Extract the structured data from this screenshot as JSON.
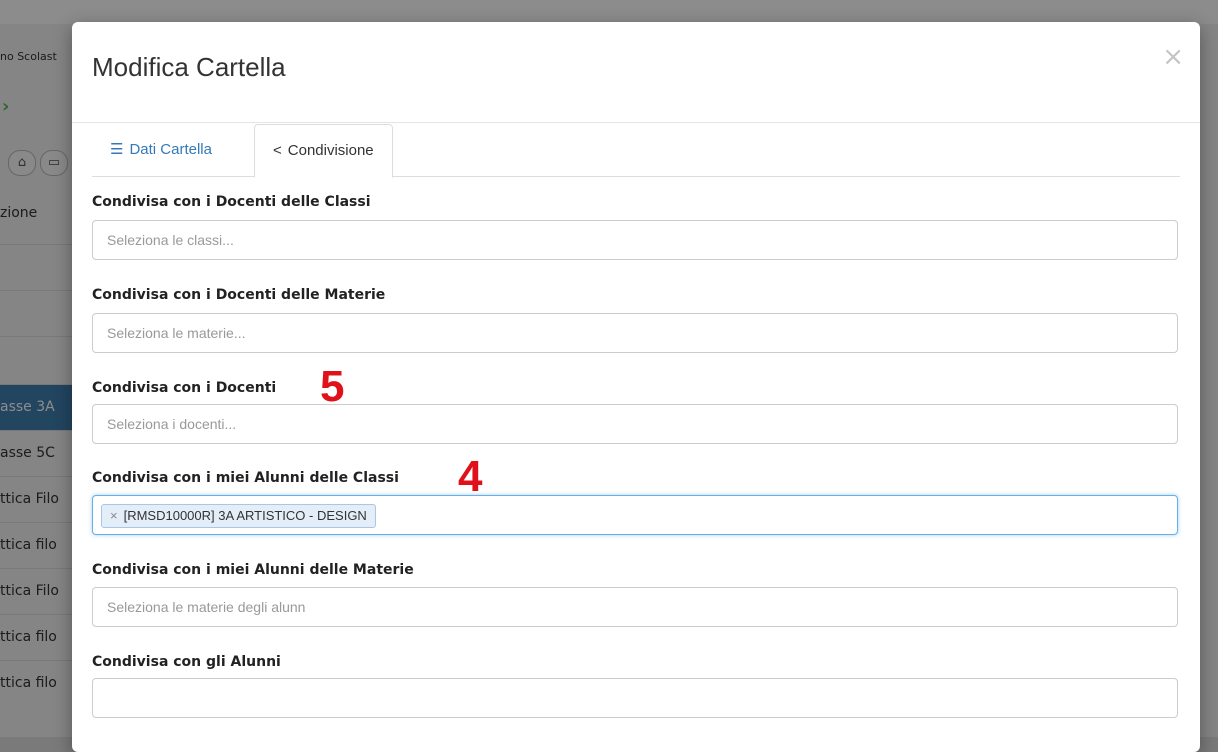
{
  "background": {
    "top_left_text": "no Scolast",
    "header_column": "zione",
    "sidebar_items": [
      "asse 3A",
      "asse 5C",
      "ttica Filo",
      "ttica filo",
      "ttica Filo",
      "ttica filo",
      "ttica filo"
    ]
  },
  "modal": {
    "title": "Modifica Cartella",
    "close_glyph": "×",
    "tabs": [
      {
        "label": "Dati Cartella",
        "icon": "align-left-icon",
        "active": false
      },
      {
        "label": "Condivisione",
        "icon": "share-icon",
        "active": true
      }
    ],
    "fields": [
      {
        "label": "Condivisa con i Docenti delle Classi",
        "placeholder": "Seleziona le classi...",
        "tags": []
      },
      {
        "label": "Condivisa con i Docenti delle Materie",
        "placeholder": "Seleziona le materie...",
        "tags": []
      },
      {
        "label": "Condivisa con i Docenti",
        "placeholder": "Seleziona i docenti...",
        "tags": []
      },
      {
        "label": "Condivisa con i miei Alunni delle Classi",
        "placeholder": "",
        "tags": [
          "[RMSD10000R] 3A ARTISTICO - DESIGN"
        ]
      },
      {
        "label": "Condivisa con i miei Alunni delle Materie",
        "placeholder": "Seleziona le materie degli alunn",
        "tags": []
      },
      {
        "label": "Condivisa con gli Alunni",
        "placeholder": "",
        "tags": []
      }
    ],
    "annotations": {
      "five": "5",
      "four": "4"
    }
  },
  "colors": {
    "accent": "#337ab7",
    "annotation_red": "#e0111a"
  }
}
